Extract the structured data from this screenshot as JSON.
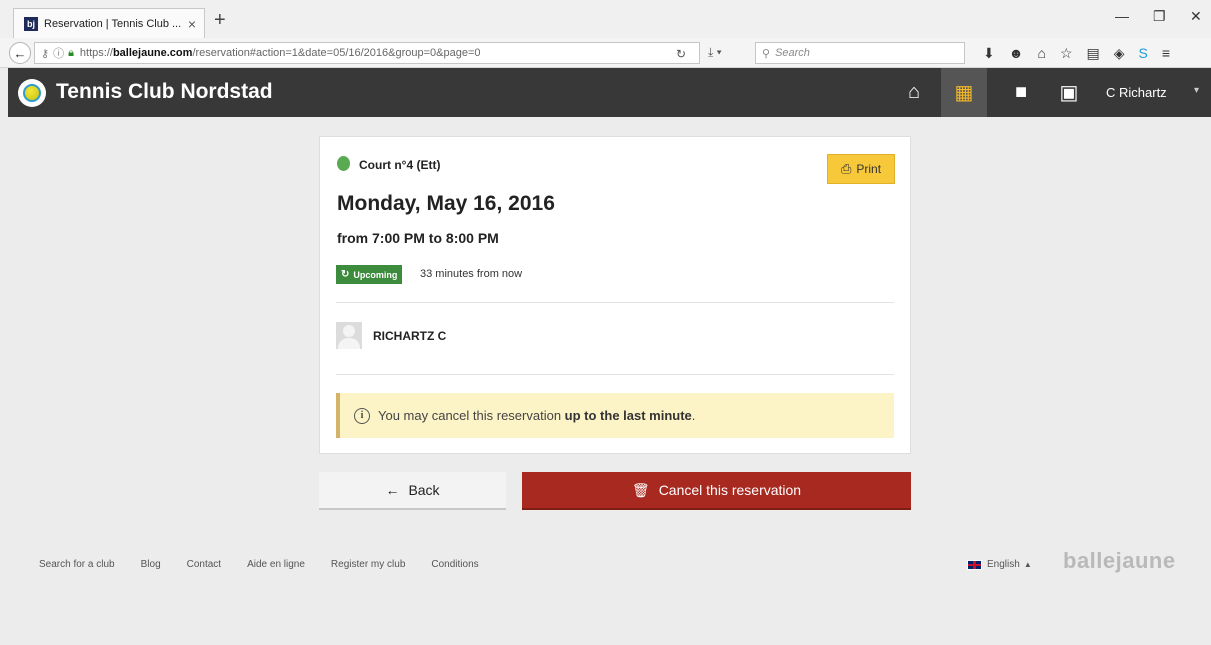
{
  "browser": {
    "tab_title": "Reservation | Tennis Club ...",
    "favicon_text": "bj",
    "url_prefix": "https://",
    "url_host": "ballejaune.com",
    "url_path": "/reservation#action=1&date=05/16/2016&group=0&page=0",
    "search_placeholder": "Search"
  },
  "header": {
    "site_title": "Tennis Club Nordstad",
    "user_name": "C Richartz"
  },
  "reservation": {
    "court": "Court n°4 (Ett)",
    "print_label": "Print",
    "date": "Monday, May 16, 2016",
    "time": "from 7:00 PM to 8:00 PM",
    "status_badge": "Upcoming",
    "relative_time": "33 minutes from now",
    "player": "RICHARTZ C",
    "notice_text": "You may cancel this reservation ",
    "notice_bold": "up to the last minute",
    "notice_end": "."
  },
  "actions": {
    "back_label": "Back",
    "cancel_label": "Cancel this reservation"
  },
  "footer": {
    "links": [
      "Search for a club",
      "Blog",
      "Contact",
      "Aide en ligne",
      "Register my club",
      "Conditions"
    ],
    "language": "English",
    "brand": "ballejaune"
  },
  "colors": {
    "header_bg": "#383838",
    "active_icon": "#f3b82a",
    "print_button": "#f6c83a",
    "badge_green": "#3d8b3d",
    "cancel_red": "#a8291f",
    "notice_bg": "#fcf4c7"
  }
}
